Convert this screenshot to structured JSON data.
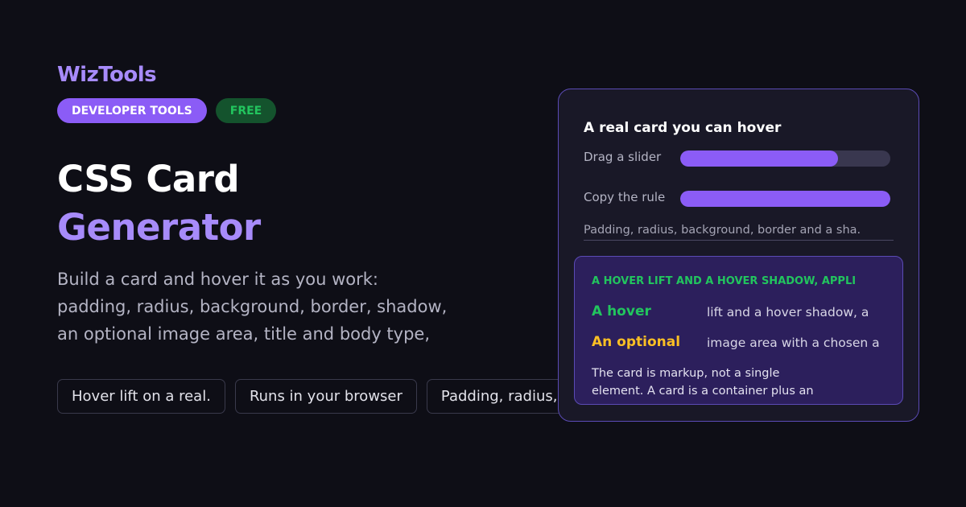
{
  "brand": "WizTools",
  "badges": {
    "category": "DEVELOPER TOOLS",
    "price": "FREE"
  },
  "title": {
    "line1": "CSS Card",
    "line2": "Generator"
  },
  "description": [
    "Build a card and hover it as you work:",
    "padding, radius, background, border, shadow,",
    "an optional image area, title and body type,"
  ],
  "chips": [
    "Hover lift on a real.",
    "Runs in your browser",
    "Padding, radius, b"
  ],
  "preview_card": {
    "title": "A real card you can hover",
    "rows": [
      {
        "label": "Drag a slider",
        "fill_fraction": 0.75
      },
      {
        "label": "Copy the rule",
        "fill_fraction": 1.0
      }
    ],
    "note": "Padding, radius, background, border and a sha.",
    "inner": {
      "heading": "A HOVER LIFT AND A HOVER SHADOW, APPLI",
      "rows": [
        {
          "key": "A hover",
          "value": "lift and a hover shadow, a",
          "key_color": "#22c55e"
        },
        {
          "key": "An optional",
          "value": "image area with a chosen a",
          "key_color": "#fbbf24"
        }
      ],
      "body": [
        "The card is markup, not a single",
        "element. A card is a container plus an"
      ]
    }
  },
  "colors": {
    "background": "#0e0e16",
    "accent": "#8b5cf6",
    "accent_text": "#a78bfa",
    "success": "#22c55e",
    "warning": "#fbbf24"
  }
}
